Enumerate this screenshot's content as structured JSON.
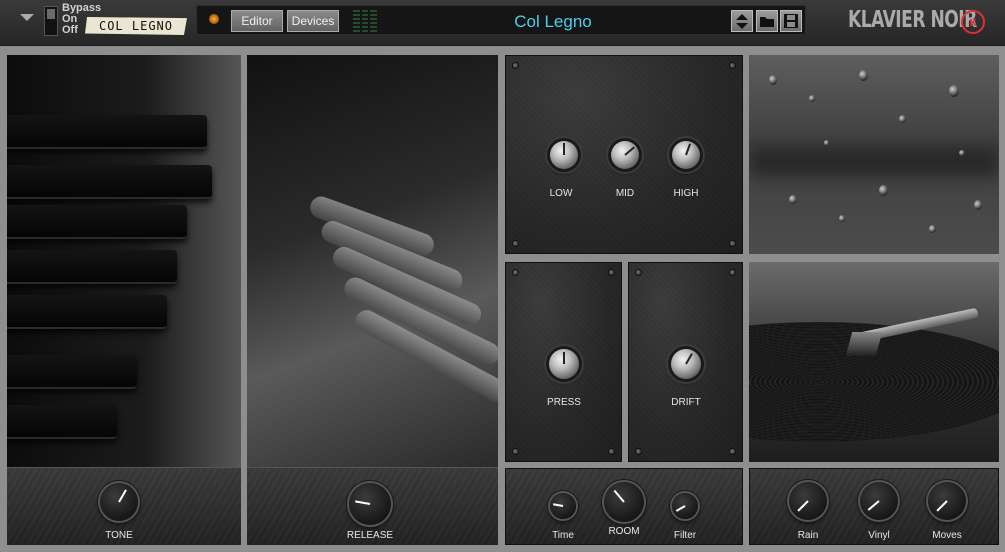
{
  "header": {
    "bypass_label": "Bypass",
    "on_label": "On",
    "off_label": "Off",
    "patch_name": "COL LEGNO",
    "editor_button": "Editor",
    "devices_button": "Devices",
    "preset_name": "Col Legno",
    "brand": "KLAVIER NOIR",
    "brand_logo": "ĸ"
  },
  "panels": {
    "tone": {
      "label": "TONE"
    },
    "release": {
      "label": "RELEASE"
    },
    "eq": {
      "low": "LOW",
      "mid": "MID",
      "high": "HIGH"
    },
    "press": {
      "label": "PRESS"
    },
    "drift": {
      "label": "DRIFT"
    },
    "room": {
      "time": "Time",
      "room": "ROOM",
      "filter": "Filter"
    },
    "noise": {
      "rain": "Rain",
      "vinyl": "Vinyl",
      "moves": "Moves"
    }
  },
  "colors": {
    "preset_text": "#4ad0e8",
    "brand_logo": "#e03030",
    "panel_bg": "#8e8e8e"
  },
  "icons": {
    "fold": "triangle-down-icon",
    "folder": "folder-icon",
    "save": "save-icon"
  }
}
